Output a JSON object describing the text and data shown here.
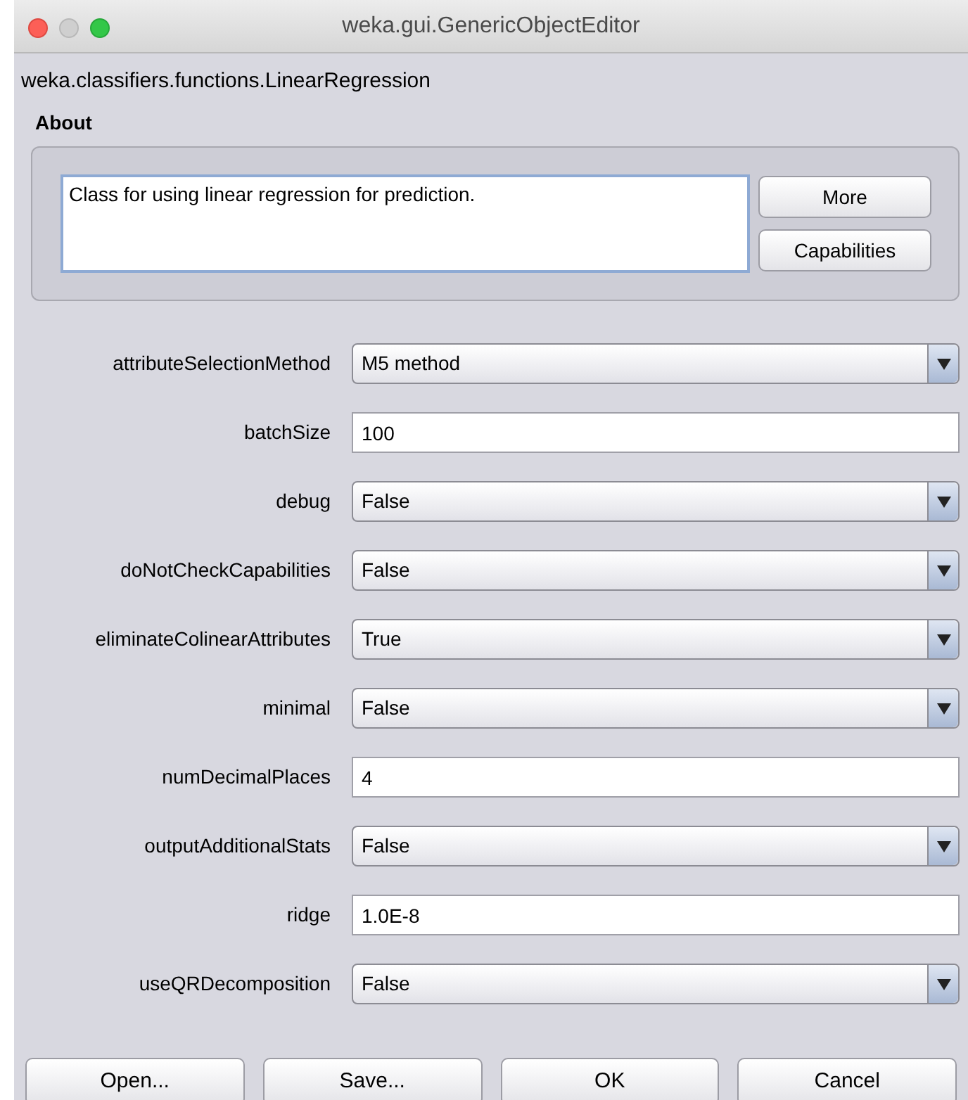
{
  "window": {
    "title": "weka.gui.GenericObjectEditor"
  },
  "class_name": "weka.classifiers.functions.LinearRegression",
  "about": {
    "title": "About",
    "description": "Class for using linear regression for prediction.",
    "buttons": [
      "More",
      "Capabilities"
    ]
  },
  "properties": [
    {
      "label": "attributeSelectionMethod",
      "kind": "dropdown",
      "value": "M5 method"
    },
    {
      "label": "batchSize",
      "kind": "text",
      "value": "100"
    },
    {
      "label": "debug",
      "kind": "dropdown",
      "value": "False"
    },
    {
      "label": "doNotCheckCapabilities",
      "kind": "dropdown",
      "value": "False"
    },
    {
      "label": "eliminateColinearAttributes",
      "kind": "dropdown",
      "value": "True"
    },
    {
      "label": "minimal",
      "kind": "dropdown",
      "value": "False"
    },
    {
      "label": "numDecimalPlaces",
      "kind": "text",
      "value": "4"
    },
    {
      "label": "outputAdditionalStats",
      "kind": "dropdown",
      "value": "False"
    },
    {
      "label": "ridge",
      "kind": "text",
      "value": "1.0E-8"
    },
    {
      "label": "useQRDecomposition",
      "kind": "dropdown",
      "value": "False"
    }
  ],
  "buttons": [
    "Open...",
    "Save...",
    "OK",
    "Cancel"
  ]
}
